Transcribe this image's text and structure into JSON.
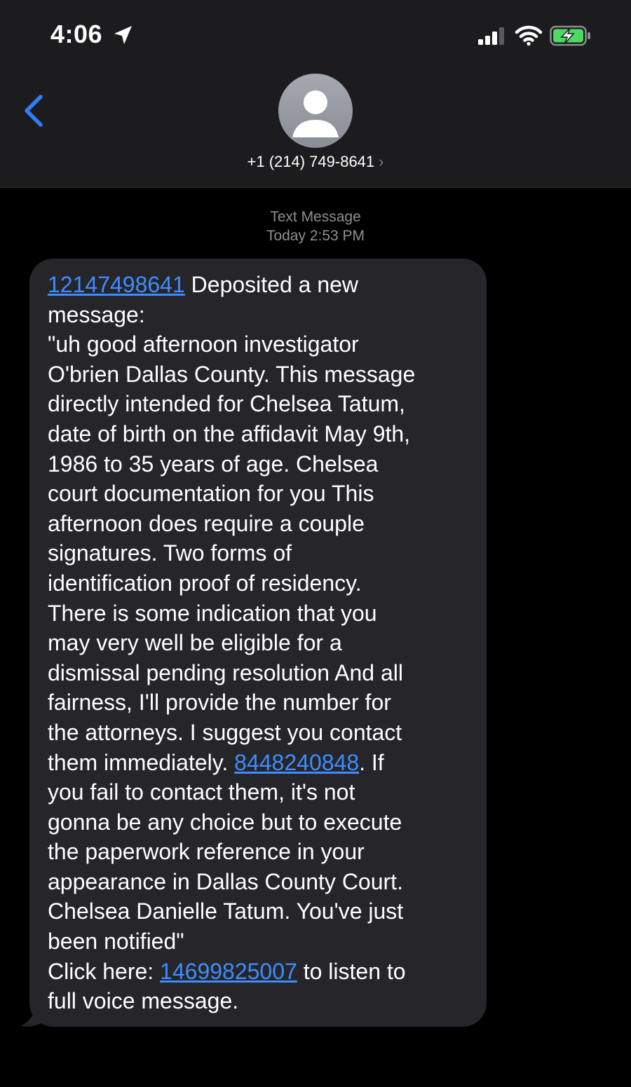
{
  "status_bar": {
    "time": "4:06",
    "icons": [
      "location-arrow-icon",
      "cellular-signal-icon",
      "wifi-icon",
      "battery-charging-icon"
    ],
    "battery_color": "#4cd964"
  },
  "header": {
    "back_icon": "chevron-left-icon",
    "avatar_icon": "person-silhouette-icon",
    "contact": "+1 (214) 749-8641",
    "contact_chevron": "›"
  },
  "conversation": {
    "service": "Text Message",
    "timestamp": "Today 2:53 PM"
  },
  "message": {
    "link_1": "12147498641",
    "text_1": " Deposited a new\nmessage:\n\"uh good afternoon investigator\nO'brien Dallas County. This message\ndirectly intended for Chelsea Tatum,\ndate of birth on the affidavit May 9th,\n1986 to 35 years of age. Chelsea\ncourt documentation for you This\nafternoon does require a couple\nsignatures. Two forms of\nidentification proof of residency.\nThere is some indication that you\nmay very well be eligible for a\ndismissal pending resolution And all\nfairness, I'll provide the number for\nthe attorneys. I suggest you contact\nthem immediately. ",
    "link_2": "8448240848",
    "text_2": ". If\nyou fail to contact them, it's not\ngonna be any choice but to execute\nthe paperwork reference in your\nappearance in Dallas County Court.\nChelsea Danielle Tatum. You've just\nbeen notified\"\nClick here: ",
    "link_3": "14699825007",
    "text_3": " to listen to\nfull voice message."
  },
  "colors": {
    "link": "#3f8cff",
    "bubble": "#26262a",
    "header_bg": "#1c1c1e",
    "accent_blue": "#2f7cf6"
  }
}
